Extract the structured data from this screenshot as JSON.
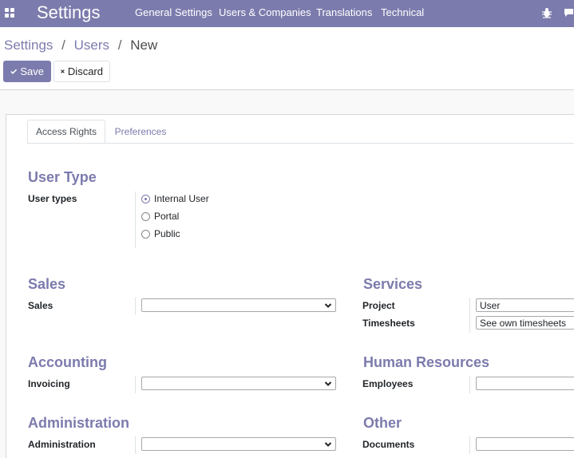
{
  "navbar": {
    "brand": "Settings",
    "menu": [
      "General Settings",
      "Users & Companies",
      "Translations",
      "Technical"
    ]
  },
  "breadcrumb": {
    "items": [
      "Settings",
      "Users"
    ],
    "active": "New",
    "separator": "/"
  },
  "toolbar": {
    "save_label": "Save",
    "discard_label": "Discard"
  },
  "tabs": {
    "active": "Access Rights",
    "inactive": "Preferences"
  },
  "user_type": {
    "title": "User Type",
    "label": "User types",
    "options": [
      "Internal User",
      "Portal",
      "Public"
    ],
    "selected": "Internal User"
  },
  "groups": {
    "sales": {
      "title": "Sales",
      "fields": [
        {
          "label": "Sales",
          "value": ""
        }
      ]
    },
    "services": {
      "title": "Services",
      "fields": [
        {
          "label": "Project",
          "value": "User"
        },
        {
          "label": "Timesheets",
          "value": "See own timesheets"
        }
      ]
    },
    "accounting": {
      "title": "Accounting",
      "fields": [
        {
          "label": "Invoicing",
          "value": ""
        }
      ]
    },
    "hr": {
      "title": "Human Resources",
      "fields": [
        {
          "label": "Employees",
          "value": ""
        }
      ]
    },
    "administration": {
      "title": "Administration",
      "fields": [
        {
          "label": "Administration",
          "value": ""
        }
      ]
    },
    "other": {
      "title": "Other",
      "fields": [
        {
          "label": "Documents",
          "value": ""
        }
      ]
    }
  },
  "colors": {
    "brand": "#7c7bad",
    "text": "#212529",
    "border": "#dee2e6"
  }
}
